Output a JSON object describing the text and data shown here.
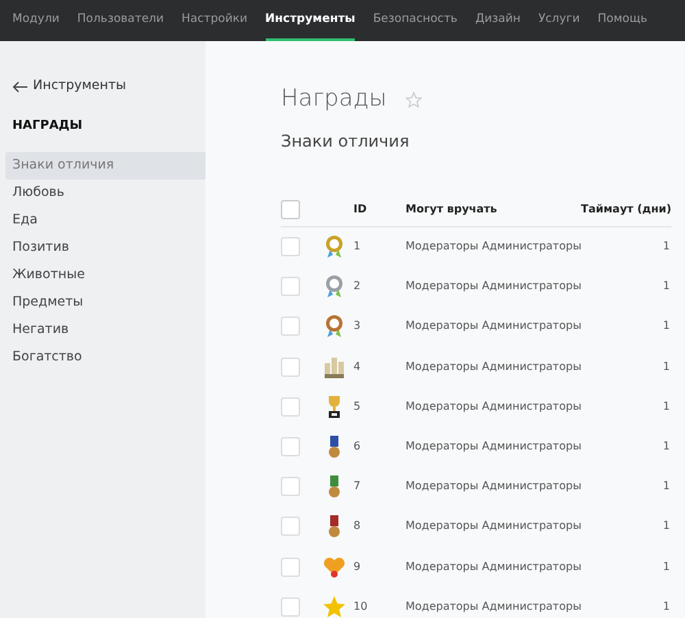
{
  "nav": [
    {
      "label": "Модули",
      "selected": false
    },
    {
      "label": "Пользователи",
      "selected": false
    },
    {
      "label": "Настройки",
      "selected": false
    },
    {
      "label": "Инструменты",
      "selected": true
    },
    {
      "label": "Безопасность",
      "selected": false
    },
    {
      "label": "Дизайн",
      "selected": false
    },
    {
      "label": "Услуги",
      "selected": false
    },
    {
      "label": "Помощь",
      "selected": false
    }
  ],
  "sidebar": {
    "back": "Инструменты",
    "heading": "НАГРАДЫ",
    "items": [
      {
        "label": "Знаки отличия",
        "selected": true
      },
      {
        "label": "Любовь",
        "selected": false
      },
      {
        "label": "Еда",
        "selected": false
      },
      {
        "label": "Позитив",
        "selected": false
      },
      {
        "label": "Животные",
        "selected": false
      },
      {
        "label": "Предметы",
        "selected": false
      },
      {
        "label": "Негатив",
        "selected": false
      },
      {
        "label": "Богатство",
        "selected": false
      }
    ]
  },
  "page": {
    "title": "Награды",
    "subtitle": "Знаки отличия"
  },
  "table": {
    "select_all_checked": false,
    "columns": [
      "ID",
      "Могут вручать",
      "Таймаут (дни)"
    ],
    "rows": [
      {
        "checked": false,
        "kind": "rosette_gold",
        "id": "1",
        "givers": "Модераторы Администраторы",
        "timeout": "1"
      },
      {
        "checked": false,
        "kind": "rosette_silver",
        "id": "2",
        "givers": "Модераторы Администраторы",
        "timeout": "1"
      },
      {
        "checked": false,
        "kind": "rosette_bronze",
        "id": "3",
        "givers": "Модераторы Администраторы",
        "timeout": "1"
      },
      {
        "checked": false,
        "kind": "towers",
        "id": "4",
        "givers": "Модераторы Администраторы",
        "timeout": "1"
      },
      {
        "checked": false,
        "kind": "cup",
        "id": "5",
        "givers": "Модераторы Администраторы",
        "timeout": "1"
      },
      {
        "checked": false,
        "kind": "medal_blue",
        "id": "6",
        "givers": "Модераторы Администраторы",
        "timeout": "1"
      },
      {
        "checked": false,
        "kind": "medal_green",
        "id": "7",
        "givers": "Модераторы Администраторы",
        "timeout": "1"
      },
      {
        "checked": false,
        "kind": "medal_red",
        "id": "8",
        "givers": "Модераторы Администраторы",
        "timeout": "1"
      },
      {
        "checked": false,
        "kind": "hearts",
        "id": "9",
        "givers": "Модераторы Администраторы",
        "timeout": "1"
      },
      {
        "checked": false,
        "kind": "star",
        "id": "10",
        "givers": "Модераторы Администраторы",
        "timeout": "1"
      }
    ]
  }
}
